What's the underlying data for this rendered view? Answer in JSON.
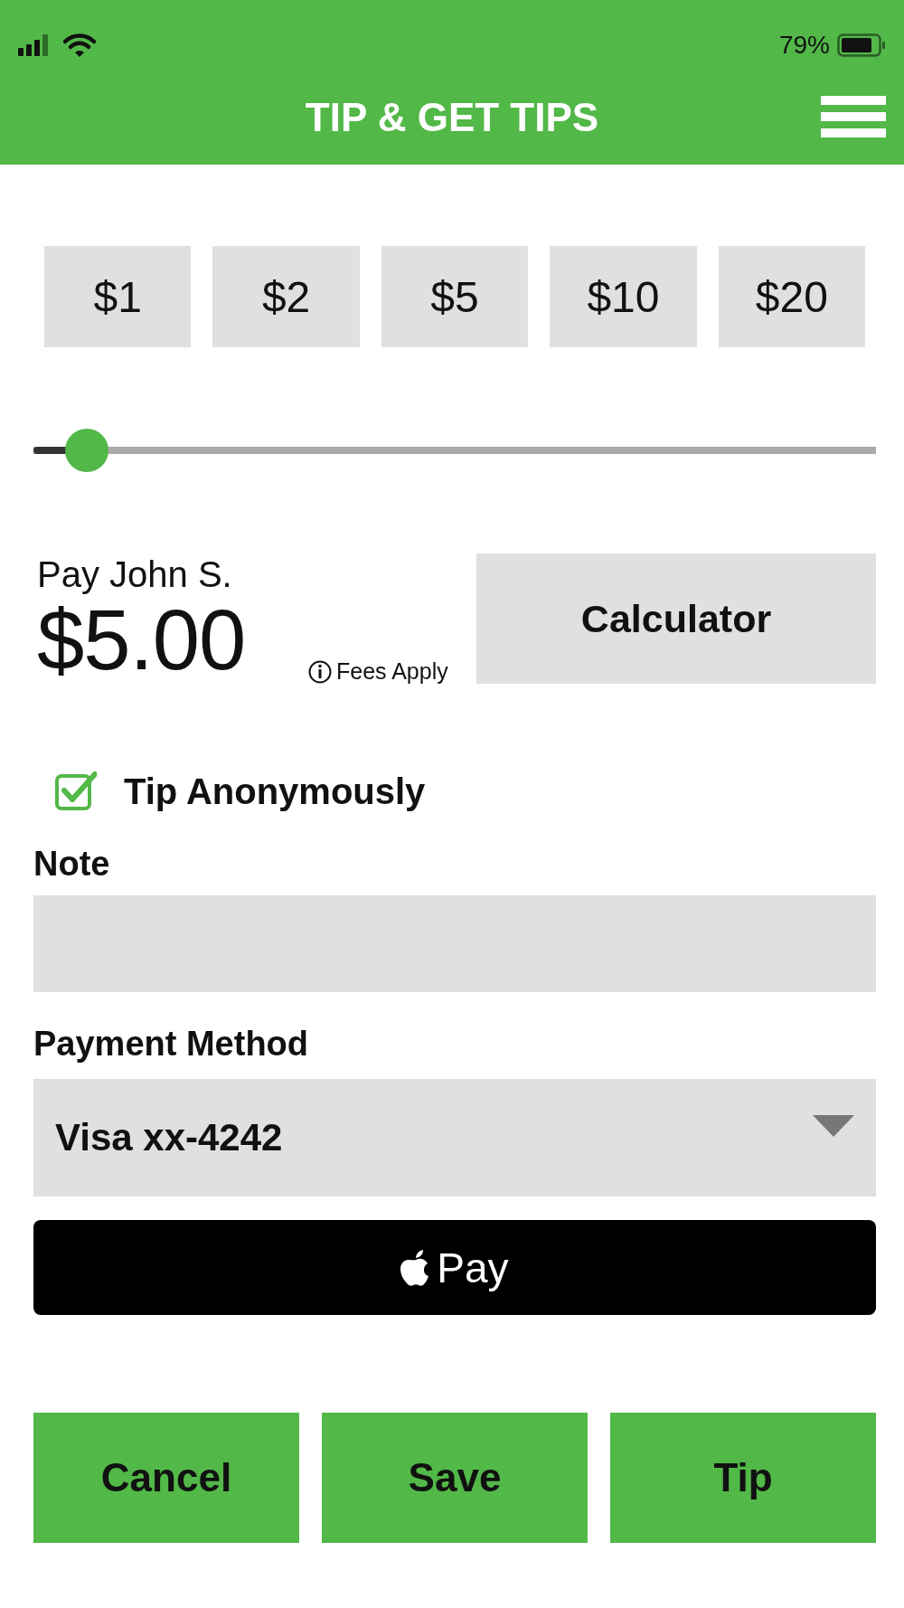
{
  "status_bar": {
    "battery": "79%"
  },
  "header": {
    "title": "TIP & GET TIPS"
  },
  "presets": [
    "$1",
    "$2",
    "$5",
    "$10",
    "$20"
  ],
  "slider": {
    "level": 0.063
  },
  "payee": {
    "label": "Pay John S.",
    "amount": "$5.00",
    "fees_note": "Fees Apply"
  },
  "calculator_button": "Calculator",
  "anonymous": {
    "label": "Tip Anonymously",
    "checked": true
  },
  "note": {
    "label": "Note"
  },
  "payment": {
    "label": "Payment Method",
    "value": "Visa xx-4242"
  },
  "apple_pay": {
    "label": "Pay"
  },
  "actions": [
    "Cancel",
    "Save",
    "Tip"
  ]
}
